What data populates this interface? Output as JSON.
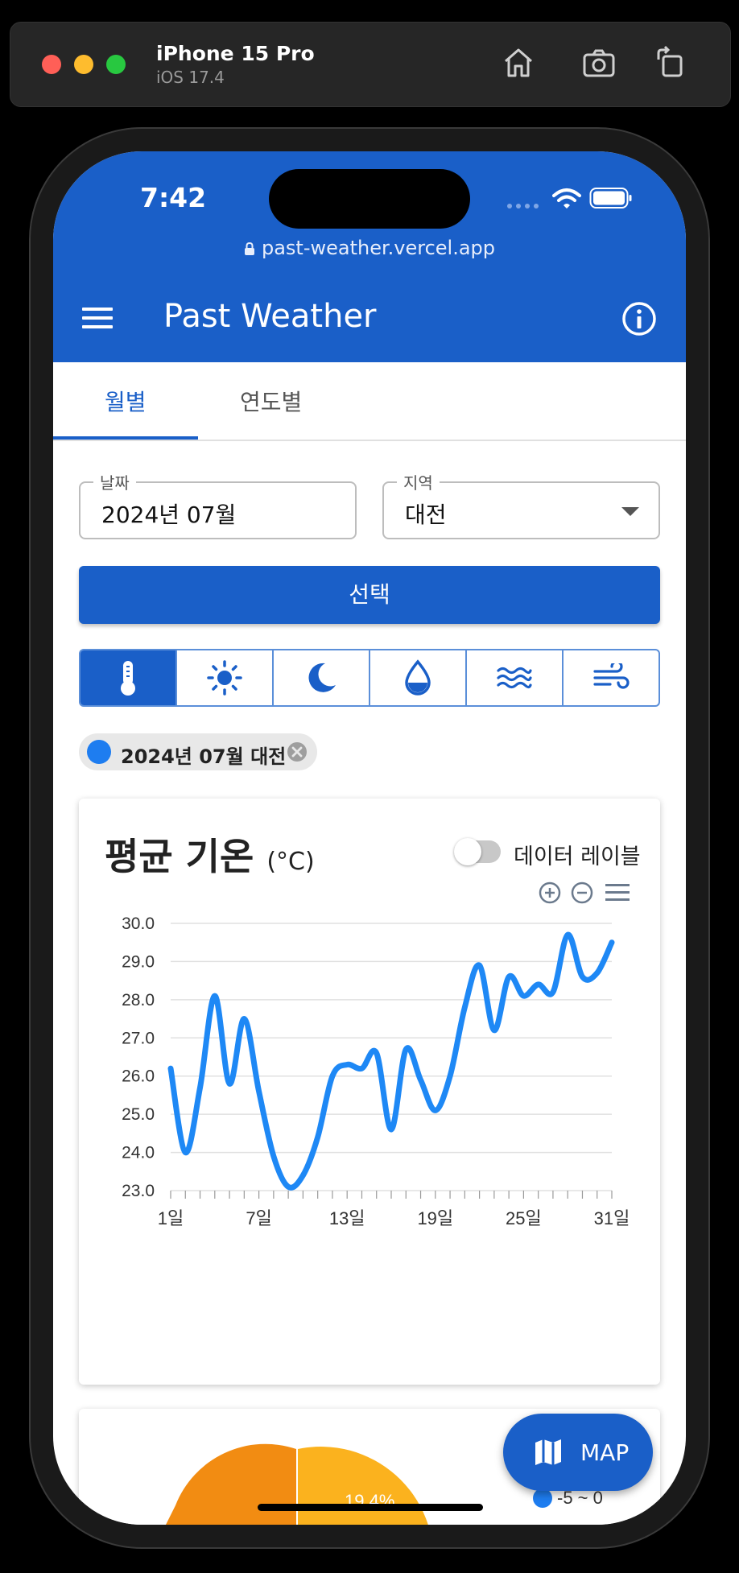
{
  "simulator": {
    "device": "iPhone 15 Pro",
    "os": "iOS 17.4"
  },
  "status_bar": {
    "time": "7:42"
  },
  "browser": {
    "url": "past-weather.vercel.app"
  },
  "appbar": {
    "title": "Past Weather"
  },
  "tabs": [
    {
      "label": "월별",
      "active": true
    },
    {
      "label": "연도별",
      "active": false
    }
  ],
  "form": {
    "date_label": "날짜",
    "date_value": "2024년 07월",
    "region_label": "지역",
    "region_value": "대전",
    "select_button": "선택"
  },
  "metric_icons": [
    "thermometer-icon",
    "sun-icon",
    "moon-icon",
    "water-drop-icon",
    "waves-icon",
    "wind-icon"
  ],
  "chip": {
    "label": "2024년 07월 대전",
    "color": "#1e7df0"
  },
  "chart_card": {
    "title": "평균 기온",
    "unit": "(°C)",
    "toggle_label": "데이터 레이블",
    "toggle_on": false
  },
  "chart_data": {
    "type": "line",
    "x": [
      1,
      2,
      3,
      4,
      5,
      6,
      7,
      8,
      9,
      10,
      11,
      12,
      13,
      14,
      15,
      16,
      17,
      18,
      19,
      20,
      21,
      22,
      23,
      24,
      25,
      26,
      27,
      28,
      29,
      30,
      31
    ],
    "series": [
      {
        "values": [
          26.2,
          24.0,
          25.7,
          28.1,
          25.8,
          27.5,
          25.6,
          23.9,
          23.1,
          23.4,
          24.4,
          26.0,
          26.3,
          26.2,
          26.6,
          24.6,
          26.7,
          25.9,
          25.1,
          26.0,
          27.8,
          28.9,
          27.2,
          28.6,
          28.1,
          28.4,
          28.2,
          29.7,
          28.6,
          28.7,
          29.5
        ],
        "color": "#1e88f5"
      }
    ],
    "ylim": [
      23.0,
      30.0
    ],
    "yticks": [
      "30.0",
      "29.0",
      "28.0",
      "27.0",
      "26.0",
      "25.0",
      "24.0",
      "23.0"
    ],
    "xtick_labels": [
      "1일",
      "7일",
      "13일",
      "19일",
      "25일",
      "31일"
    ],
    "grid": true
  },
  "second_card": {
    "slice_label": "19.4%",
    "legend_entry": "-5 ~ 0"
  },
  "fab": {
    "label": "MAP"
  }
}
